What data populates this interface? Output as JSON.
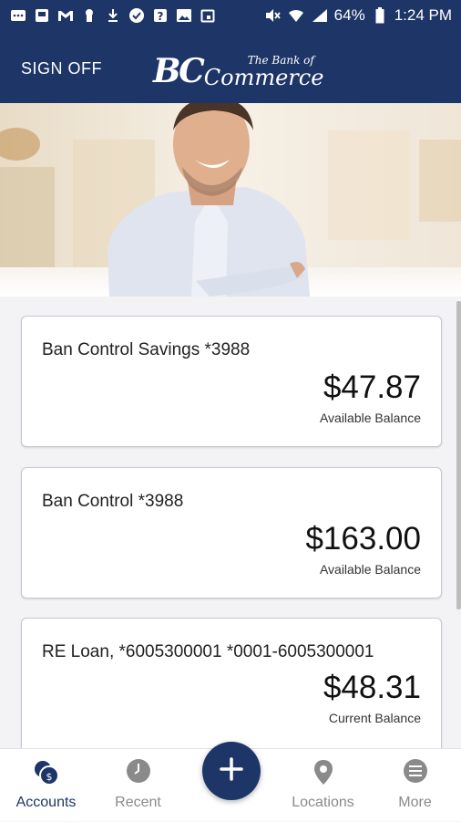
{
  "status_bar": {
    "battery": "64%",
    "time": "1:24 PM"
  },
  "header": {
    "sign_off_label": "SIGN OFF",
    "logo": {
      "monogram": "BC",
      "small_text": "The Bank of",
      "large_text": "Commerce"
    }
  },
  "accounts": [
    {
      "name": "Ban Control Savings *3988",
      "amount": "$47.87",
      "balance_label": "Available Balance"
    },
    {
      "name": "Ban Control *3988",
      "amount": "$163.00",
      "balance_label": "Available Balance"
    },
    {
      "name": "RE Loan, *6005300001 *0001-6005300001",
      "amount": "$48.31",
      "balance_label": "Current Balance"
    }
  ],
  "bottom_nav": {
    "items": [
      {
        "label": "Accounts",
        "icon": "accounts-icon",
        "active": true
      },
      {
        "label": "Recent",
        "icon": "clock-icon",
        "active": false
      },
      {
        "label": "Locations",
        "icon": "location-pin-icon",
        "active": false
      },
      {
        "label": "More",
        "icon": "menu-icon",
        "active": false
      }
    ],
    "fab_icon": "plus-icon"
  },
  "colors": {
    "brand_navy": "#1d3667",
    "inactive_gray": "#8a8a8a"
  }
}
